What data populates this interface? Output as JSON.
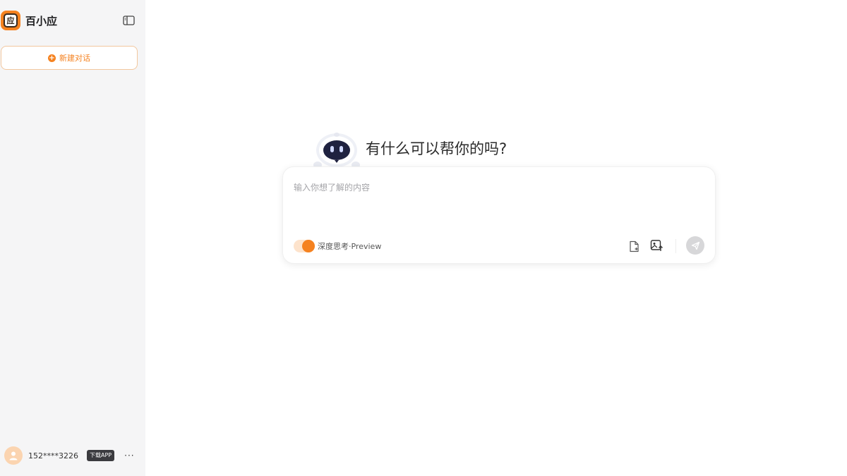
{
  "sidebar": {
    "brand_name": "百小应",
    "logo_glyph": "应",
    "new_chat_label": "新建对话",
    "user": {
      "phone": "152****3226",
      "download_label": "下载APP",
      "more_label": "···"
    }
  },
  "main": {
    "greeting": "有什么可以帮你的吗?",
    "composer": {
      "placeholder": "输入你想了解的内容",
      "value": "",
      "deep_think_label": "深度思考·Preview",
      "deep_think_enabled": true
    }
  },
  "icons": {
    "collapse": "sidebar-collapse-icon",
    "plus": "plus-circle-icon",
    "avatar": "user-avatar-icon",
    "mascot": "robot-mascot-icon",
    "file_upload": "file-upload-icon",
    "image_upload": "image-upload-icon",
    "send": "send-icon"
  },
  "colors": {
    "accent": "#f58220",
    "sidebar_bg": "#f5f5f6",
    "send_disabled": "#d7d7d9"
  }
}
